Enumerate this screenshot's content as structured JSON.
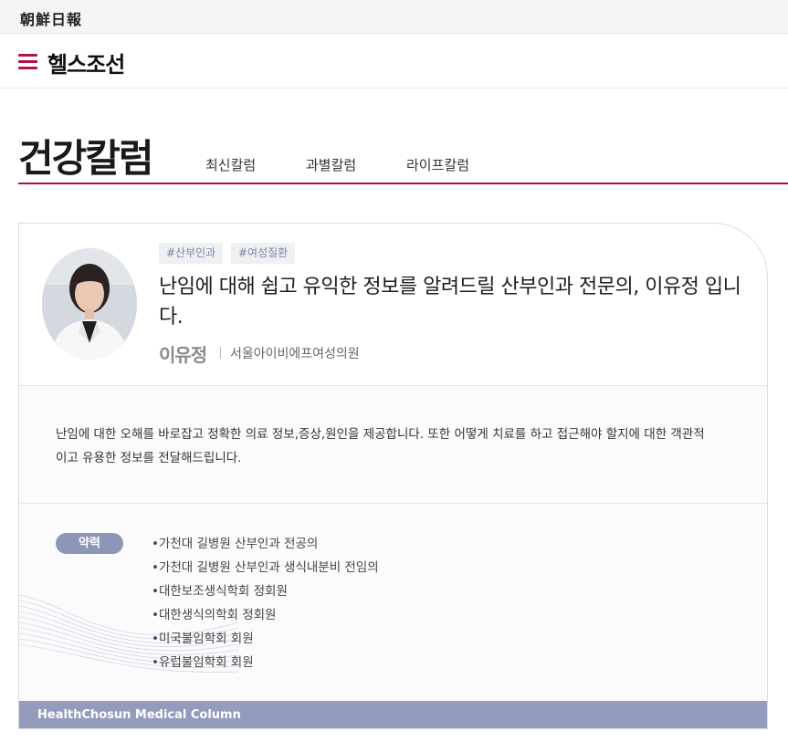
{
  "topbar": {
    "logo": "朝鮮日報"
  },
  "header": {
    "brand": "헬스조선",
    "menu_icon": "hamburger-menu-icon"
  },
  "page": {
    "title": "건강칼럼",
    "subnav": [
      "최신칼럼",
      "과별칼럼",
      "라이프칼럼"
    ]
  },
  "profile": {
    "tags": [
      "#산부인과",
      "#여성질환"
    ],
    "headline": "난임에 대해 쉽고 유익한 정보를 알려드릴 산부인과 전문의, 이유정 입니다.",
    "author_name": "이유정",
    "clinic": "서울아이비에프여성의원",
    "intro": "난임에 대한 오해를 바로잡고 정확한 의료 정보,증상,원인을 제공합니다. 또한 어떻게 치료를 하고 접근해야 할지에 대한 객관적이고 유용한 정보를 전달해드립니다.",
    "career_label": "약력",
    "career": [
      "•가천대 길병원 산부인과 전공의",
      "•가천대 길병원 산부인과 생식내분비 전임의",
      "•대한보조생식학회 정회원",
      "•대한생식의학회 정회원",
      "•미국불임학회 회원",
      "•유럽불임학회 회원"
    ]
  },
  "footer": {
    "text": "HealthChosun Medical Column"
  },
  "colors": {
    "accent": "#a8124a",
    "slate": "#949cbd"
  }
}
